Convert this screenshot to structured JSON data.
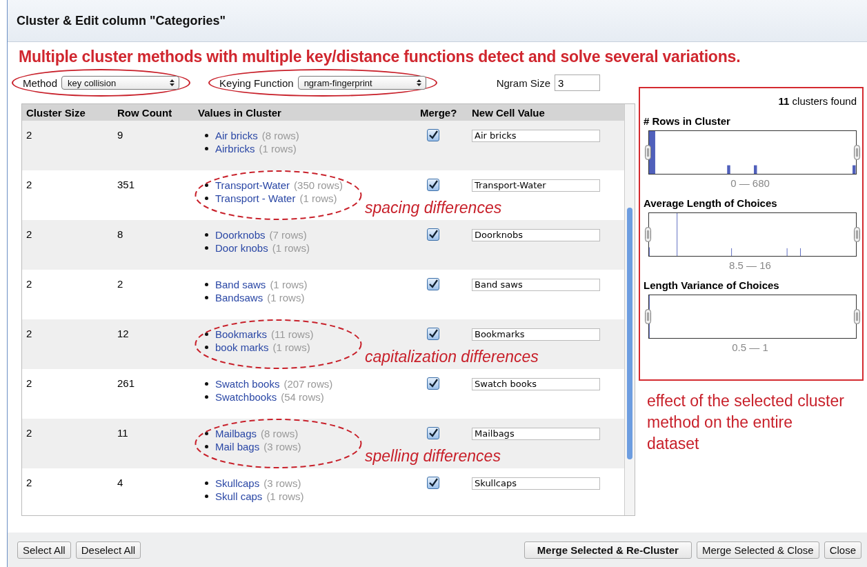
{
  "dialog": {
    "title": "Cluster & Edit column \"Categories\""
  },
  "headline_annotation": "Multiple cluster methods with multiple key/distance functions detect and solve several variations.",
  "controls": {
    "method": {
      "label": "Method",
      "value": "key collision",
      "circled": true
    },
    "keying_function": {
      "label": "Keying Function",
      "value": "ngram-fingerprint",
      "circled": true
    },
    "ngram_size": {
      "label": "Ngram Size",
      "value": "3"
    }
  },
  "table": {
    "columns": [
      "Cluster Size",
      "Row Count",
      "Values in Cluster",
      "Merge?",
      "New Cell Value"
    ],
    "rows": [
      {
        "cluster_size": "2",
        "row_count": "9",
        "values": [
          {
            "value": "Air bricks",
            "count": "(8 rows)"
          },
          {
            "value": "Airbricks",
            "count": "(1 rows)"
          }
        ],
        "merge": true,
        "new_value": "Air bricks"
      },
      {
        "cluster_size": "2",
        "row_count": "351",
        "values": [
          {
            "value": "Transport-Water",
            "count": "(350 rows)"
          },
          {
            "value": "Transport - Water",
            "count": "(1 rows)"
          }
        ],
        "merge": true,
        "new_value": "Transport-Water",
        "annotation": "spacing differences"
      },
      {
        "cluster_size": "2",
        "row_count": "8",
        "values": [
          {
            "value": "Doorknobs",
            "count": "(7 rows)"
          },
          {
            "value": "Door knobs",
            "count": "(1 rows)"
          }
        ],
        "merge": true,
        "new_value": "Doorknobs"
      },
      {
        "cluster_size": "2",
        "row_count": "2",
        "values": [
          {
            "value": "Band saws",
            "count": "(1 rows)"
          },
          {
            "value": "Bandsaws",
            "count": "(1 rows)"
          }
        ],
        "merge": true,
        "new_value": "Band saws"
      },
      {
        "cluster_size": "2",
        "row_count": "12",
        "values": [
          {
            "value": "Bookmarks",
            "count": "(11 rows)"
          },
          {
            "value": "book marks",
            "count": "(1 rows)"
          }
        ],
        "merge": true,
        "new_value": "Bookmarks",
        "annotation": "capitalization differences"
      },
      {
        "cluster_size": "2",
        "row_count": "261",
        "values": [
          {
            "value": "Swatch books",
            "count": "(207 rows)"
          },
          {
            "value": "Swatchbooks",
            "count": "(54 rows)"
          }
        ],
        "merge": true,
        "new_value": "Swatch books"
      },
      {
        "cluster_size": "2",
        "row_count": "11",
        "values": [
          {
            "value": "Mailbags",
            "count": "(8 rows)"
          },
          {
            "value": "Mail bags",
            "count": "(3 rows)"
          }
        ],
        "merge": true,
        "new_value": "Mailbags",
        "annotation": "spelling differences"
      },
      {
        "cluster_size": "2",
        "row_count": "4",
        "values": [
          {
            "value": "Skullcaps",
            "count": "(3 rows)"
          },
          {
            "value": "Skull caps",
            "count": "(1 rows)"
          }
        ],
        "merge": true,
        "new_value": "Skullcaps"
      }
    ]
  },
  "facets": {
    "clusters_count": "11",
    "clusters_found_label": "clusters found",
    "histograms": [
      {
        "title": "# Rows in Cluster",
        "range": "0 — 680"
      },
      {
        "title": "Average Length of Choices",
        "range": "8.5 — 16"
      },
      {
        "title": "Length Variance of Choices",
        "range": "0.5 — 1"
      }
    ]
  },
  "side_annotation": "effect of the selected cluster method on the entire dataset",
  "footer": {
    "left_buttons": [
      "Select All",
      "Deselect All"
    ],
    "right_buttons": [
      {
        "label": "Merge Selected & Re-Cluster",
        "primary": true
      },
      {
        "label": "Merge Selected & Close",
        "primary": false
      },
      {
        "label": "Close",
        "primary": false
      }
    ]
  }
}
